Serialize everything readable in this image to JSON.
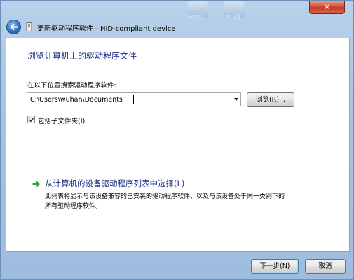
{
  "window": {
    "title": "更新驱动程序软件 - HID-compliant device",
    "close_label": "✕",
    "background_labels": [
      "WAN接口",
      "DNT设置"
    ]
  },
  "page": {
    "heading": "浏览计算机上的驱动程序文件",
    "location_label": "在以下位置搜索驱动程序软件:",
    "path_value": "C:\\Users\\wuhan\\Documents",
    "browse_label": "浏览(R)...",
    "include_subfolders_label": "包括子文件夹(I)",
    "include_subfolders_checked": true,
    "pick_title": "从计算机的设备驱动程序列表中选择(L)",
    "pick_desc_line1": "此列表将显示与该设备兼容的已安装的驱动程序软件，以及与该设备处于同一类别下的",
    "pick_desc_line2": "所有驱动程序软件。"
  },
  "footer": {
    "next_label": "下一步(N)",
    "cancel_label": "取消"
  },
  "colors": {
    "heading": "#1e3287",
    "frame": "#a7c4e3",
    "arrow_green": "#2ea043"
  },
  "icons": [
    "back-arrow-icon",
    "driver-device-icon",
    "dropdown-arrow-icon",
    "check-icon",
    "green-arrow-icon",
    "close-icon"
  ]
}
